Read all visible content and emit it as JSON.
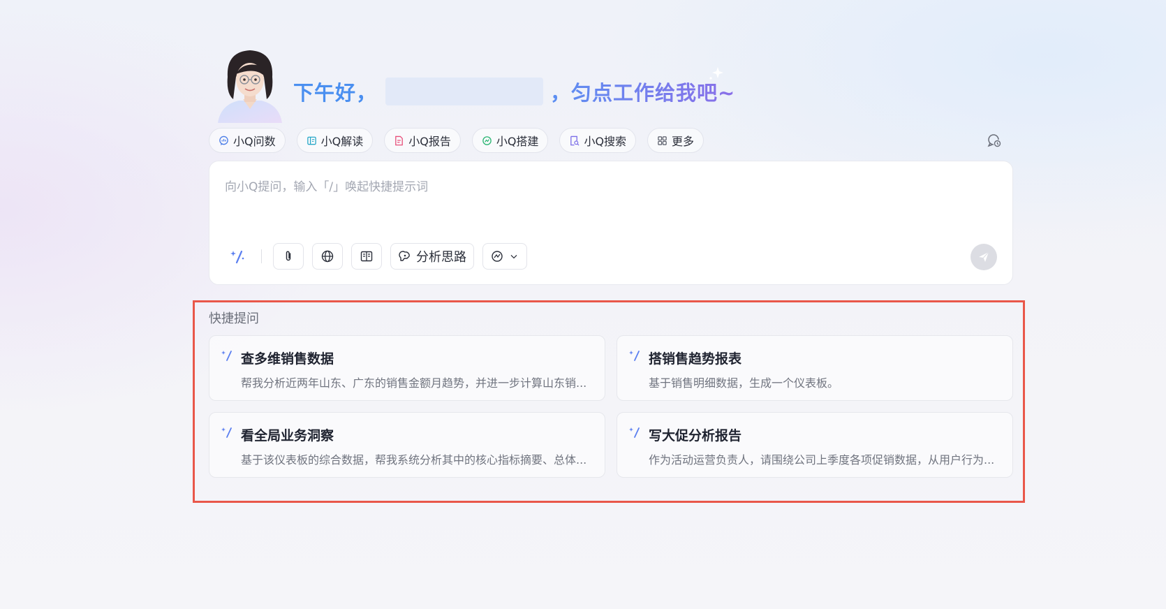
{
  "header": {
    "greeting_prefix": "下午好，",
    "greeting_suffix": "，匀点工作给我吧~"
  },
  "tabs": [
    {
      "label": "小Q问数",
      "icon": "chat-data-icon",
      "color": "#4a7de8"
    },
    {
      "label": "小Q解读",
      "icon": "book-icon",
      "color": "#29a8c8"
    },
    {
      "label": "小Q报告",
      "icon": "report-icon",
      "color": "#e8507a"
    },
    {
      "label": "小Q搭建",
      "icon": "build-icon",
      "color": "#2bb673"
    },
    {
      "label": "小Q搜索",
      "icon": "search-doc-icon",
      "color": "#7b6ee8"
    },
    {
      "label": "更多",
      "icon": "grid-icon",
      "color": "#555a66"
    }
  ],
  "input": {
    "placeholder": "向小Q提问，输入「/」唤起快捷提示词"
  },
  "toolbar": {
    "analysis_label": "分析思路"
  },
  "quick_prompts": {
    "title": "快捷提问",
    "items": [
      {
        "title": "查多维销售数据",
        "desc": "帮我分析近两年山东、广东的销售金额月趋势，并进一步计算山东销..."
      },
      {
        "title": "搭销售趋势报表",
        "desc": "基于销售明细数据，生成一个仪表板。"
      },
      {
        "title": "看全局业务洞察",
        "desc": "基于该仪表板的综合数据，帮我系统分析其中的核心指标摘要、总体..."
      },
      {
        "title": "写大促分析报告",
        "desc": "作为活动运营负责人，请围绕公司上季度各项促销数据，从用户行为..."
      }
    ]
  },
  "colors": {
    "accent": "#4a8ff0",
    "highlight_border": "#e9574a"
  }
}
